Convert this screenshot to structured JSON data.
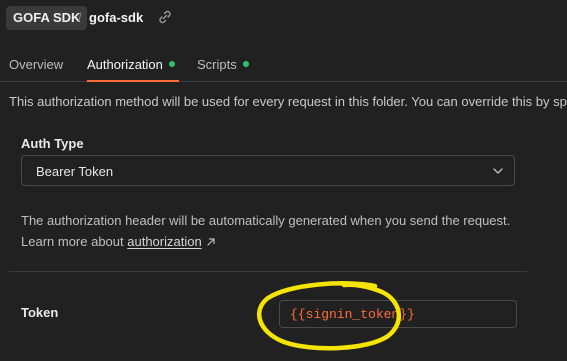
{
  "breadcrumb": {
    "collection": "GOFA SDK",
    "separator": "/",
    "current": "gofa-sdk",
    "icon": "link-icon"
  },
  "tabs": [
    {
      "label": "Overview",
      "active": false,
      "dot": false
    },
    {
      "label": "Authorization",
      "active": true,
      "dot": true
    },
    {
      "label": "Scripts",
      "active": false,
      "dot": true
    }
  ],
  "description": "This authorization method will be used for every request in this folder. You can override this by spe",
  "auth": {
    "label": "Auth Type",
    "selected": "Bearer Token",
    "icon": "chevron-down-icon"
  },
  "help": {
    "line1": "The authorization header will be automatically generated when you send the request.",
    "line2_prefix": "Learn more about",
    "link": "authorization",
    "link_icon": "external-link-arrow-icon"
  },
  "token": {
    "label": "Token",
    "value": "{{signin_token}}"
  },
  "colors": {
    "accent": "#ff6c37",
    "status_dot": "#2ec36b",
    "highlight": "#f5e300"
  }
}
